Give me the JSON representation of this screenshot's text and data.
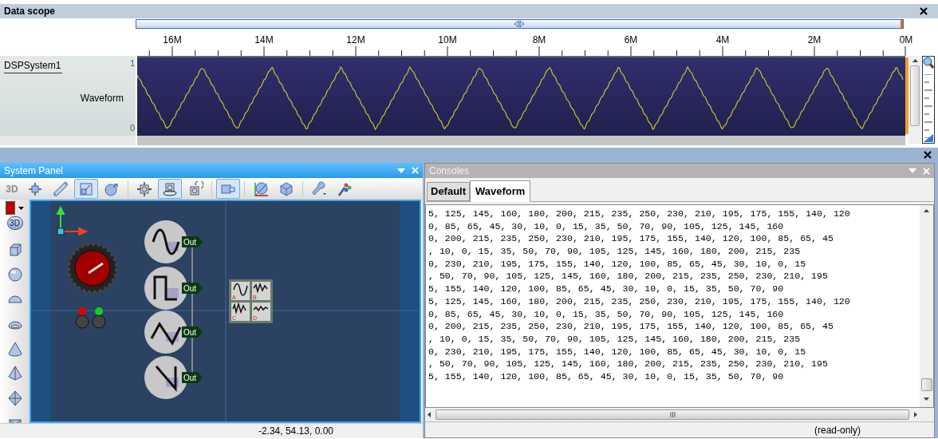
{
  "data_scope": {
    "title": "Data scope",
    "ruler_labels": [
      "16M",
      "14M",
      "12M",
      "10M",
      "8M",
      "6M",
      "4M",
      "2M",
      "0M"
    ],
    "track": {
      "name": "DSPSystem1",
      "signal": "Waveform",
      "y_max": "1",
      "y_min": "0"
    },
    "zoom": {
      "level": 0.1
    }
  },
  "system_panel": {
    "title": "System Panel",
    "mode_label": {
      "label": "3D",
      "disabled": true
    },
    "toolbar_groups": [
      [
        {
          "kind": "move",
          "selected": false
        },
        {
          "kind": "measure",
          "selected": false
        },
        {
          "kind": "scale",
          "selected": true
        },
        {
          "kind": "rotate",
          "selected": false
        }
      ],
      [
        {
          "kind": "pan",
          "selected": false
        },
        {
          "kind": "orbit",
          "selected": true
        },
        {
          "kind": "turn",
          "selected": false
        }
      ],
      [
        {
          "kind": "frame",
          "selected": true
        }
      ],
      [
        {
          "kind": "axes",
          "selected": false
        },
        {
          "kind": "solid",
          "selected": false
        }
      ],
      [
        {
          "kind": "wrench",
          "selected": false
        },
        {
          "kind": "paint",
          "selected": false
        }
      ]
    ],
    "swatch": {
      "color": "#c00000"
    },
    "view_button": {
      "label": "3D"
    },
    "shapes": [
      {
        "kind": "cube"
      },
      {
        "kind": "sphere"
      },
      {
        "kind": "dome"
      },
      {
        "kind": "lens"
      },
      {
        "kind": "cone"
      },
      {
        "kind": "pyramid"
      },
      {
        "kind": "octahedron"
      },
      {
        "kind": "box"
      }
    ],
    "canvas": {
      "leds": [
        {
          "color": "#e00000"
        },
        {
          "color": "#10d020"
        }
      ],
      "generators": [
        {
          "kind": "sine",
          "port": "Out"
        },
        {
          "kind": "square",
          "port": "Out"
        },
        {
          "kind": "triangle",
          "port": "Out"
        },
        {
          "kind": "sawtooth",
          "port": "Out"
        }
      ],
      "scope_channels": [
        "A",
        "B",
        "C",
        "D"
      ]
    },
    "status": "-2.34, 54.13, 0.00"
  },
  "consoles": {
    "title": "Consoles",
    "tabs": [
      {
        "label": "Default",
        "selected": false
      },
      {
        "label": "Waveform",
        "selected": true
      }
    ],
    "lines": [
      "5, 125, 145, 160, 180, 200, 215, 235, 250, 230, 210, 195, 175, 155, 140, 120",
      "0, 85, 65, 45, 30, 10, 0, 15, 35, 50, 70, 90, 105, 125, 145, 160",
      "0, 200, 215, 235, 250, 230, 210, 195, 175, 155, 140, 120, 100, 85, 65, 45",
      ", 10, 0, 15, 35, 50, 70, 90, 105, 125, 145, 160, 180, 200, 215, 235",
      "0, 230, 210, 195, 175, 155, 140, 120, 100, 85, 65, 45, 30, 10, 0, 15",
      ", 50, 70, 90, 105, 125, 145, 160, 180, 200, 215, 235, 250, 230, 210, 195",
      "5, 155, 140, 120, 100, 85, 65, 45, 30, 10, 0, 15, 35, 50, 70, 90",
      "5, 125, 145, 160, 180, 200, 215, 235, 250, 230, 210, 195, 175, 155, 140, 120",
      "0, 85, 65, 45, 30, 10, 0, 15, 35, 50, 70, 90, 105, 125, 145, 160",
      "0, 200, 215, 235, 250, 230, 210, 195, 175, 155, 140, 120, 100, 85, 65, 45",
      ", 10, 0, 15, 35, 50, 70, 90, 105, 125, 145, 160, 180, 200, 215, 235",
      "0, 230, 210, 195, 175, 155, 140, 120, 100, 85, 65, 45, 30, 10, 0, 15",
      ", 50, 70, 90, 105, 125, 145, 160, 180, 200, 215, 235, 250, 230, 210, 195",
      "5, 155, 140, 120, 100, 85, 65, 45, 30, 10, 0, 15, 35, 50, 70, 90"
    ],
    "status": "(read-only)"
  }
}
